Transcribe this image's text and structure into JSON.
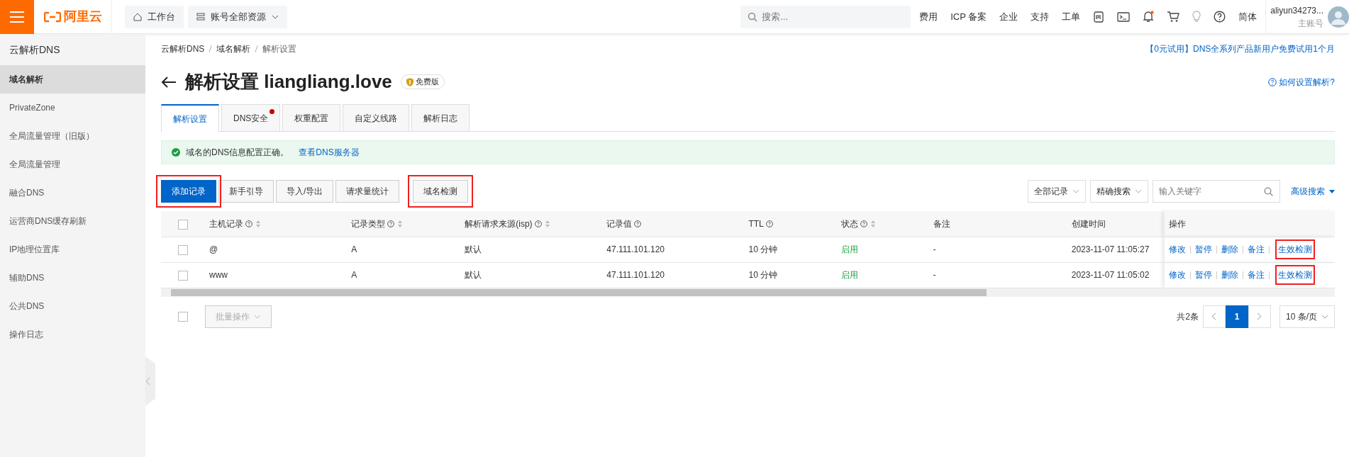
{
  "topbar": {
    "logo": "阿里云",
    "workbench": "工作台",
    "resources": "账号全部资源",
    "search": {
      "placeholder": "搜索..."
    },
    "links": [
      "费用",
      "ICP 备案",
      "企业",
      "支持",
      "工单"
    ],
    "notification_dot": true,
    "language": "简体",
    "user": {
      "name": "aliyun34273...",
      "role": "主账号"
    }
  },
  "sidebar": {
    "title": "云解析DNS",
    "items": [
      {
        "label": "域名解析",
        "selected": true
      },
      {
        "label": "PrivateZone",
        "selected": false
      },
      {
        "label": "全局流量管理（旧版）",
        "selected": false
      },
      {
        "label": "全局流量管理",
        "selected": false
      },
      {
        "label": "融合DNS",
        "selected": false
      },
      {
        "label": "运营商DNS缓存刷新",
        "selected": false
      },
      {
        "label": "IP地理位置库",
        "selected": false
      },
      {
        "label": "辅助DNS",
        "selected": false
      },
      {
        "label": "公共DNS",
        "selected": false
      },
      {
        "label": "操作日志",
        "selected": false
      }
    ]
  },
  "breadcrumb": [
    "云解析DNS",
    "域名解析",
    "解析设置"
  ],
  "promo": "【0元试用】DNS全系列产品新用户免费试用1个月",
  "title": "解析设置 liangliang.love",
  "edition": "免费版",
  "help_link": "如何设置解析?",
  "tabs": [
    {
      "label": "解析设置",
      "selected": true,
      "dot": false
    },
    {
      "label": "DNS安全",
      "selected": false,
      "dot": true
    },
    {
      "label": "权重配置",
      "selected": false,
      "dot": false
    },
    {
      "label": "自定义线路",
      "selected": false,
      "dot": false
    },
    {
      "label": "解析日志",
      "selected": false,
      "dot": false
    }
  ],
  "alert": {
    "text": "域名的DNS信息配置正确。",
    "link": "查看DNS服务器"
  },
  "toolbar": {
    "buttons": [
      {
        "label": "添加记录",
        "kind": "primary",
        "highlighted": true
      },
      {
        "label": "新手引导",
        "kind": "default",
        "highlighted": false
      },
      {
        "label": "导入/导出",
        "kind": "default",
        "highlighted": false
      },
      {
        "label": "请求量统计",
        "kind": "default",
        "highlighted": false
      },
      {
        "label": "域名检测",
        "kind": "default",
        "highlighted": true
      }
    ],
    "filter": "全部记录",
    "search_mode": "精确搜索",
    "keyword": {
      "placeholder": "输入关键字"
    },
    "advanced": "高级搜索"
  },
  "table": {
    "select_all_checked": false,
    "columns": [
      {
        "label": "主机记录",
        "help": true,
        "sortable": true
      },
      {
        "label": "记录类型",
        "help": true,
        "sortable": true
      },
      {
        "label": "解析请求来源(isp)",
        "help": true,
        "sortable": true
      },
      {
        "label": "记录值",
        "help": true,
        "sortable": false
      },
      {
        "label": "TTL",
        "help": true,
        "sortable": false
      },
      {
        "label": "状态",
        "help": true,
        "sortable": true
      },
      {
        "label": "备注",
        "help": false,
        "sortable": false
      },
      {
        "label": "创建时间",
        "help": false,
        "sortable": false
      },
      {
        "label": "操作",
        "help": false,
        "sortable": false
      }
    ],
    "rows": [
      {
        "checked": false,
        "cells": [
          "@",
          "A",
          "默认",
          "47.111.101.120",
          "10 分钟",
          "启用",
          "-",
          "2023-11-07 11:05:27"
        ],
        "actions": [
          {
            "label": "修改",
            "highlighted": false
          },
          {
            "label": "暂停",
            "highlighted": false
          },
          {
            "label": "删除",
            "highlighted": false
          },
          {
            "label": "备注",
            "highlighted": false
          },
          {
            "label": "生效检测",
            "highlighted": true
          }
        ]
      },
      {
        "checked": false,
        "cells": [
          "www",
          "A",
          "默认",
          "47.111.101.120",
          "10 分钟",
          "启用",
          "-",
          "2023-11-07 11:05:02"
        ],
        "actions": [
          {
            "label": "修改",
            "highlighted": false
          },
          {
            "label": "暂停",
            "highlighted": false
          },
          {
            "label": "删除",
            "highlighted": false
          },
          {
            "label": "备注",
            "highlighted": false
          },
          {
            "label": "生效检测",
            "highlighted": true
          }
        ]
      }
    ]
  },
  "footer": {
    "batch_checked": false,
    "batch": "批量操作",
    "total": "共2条",
    "pages": [
      {
        "label": "1",
        "selected": true
      }
    ],
    "page_size": "10 条/页"
  }
}
